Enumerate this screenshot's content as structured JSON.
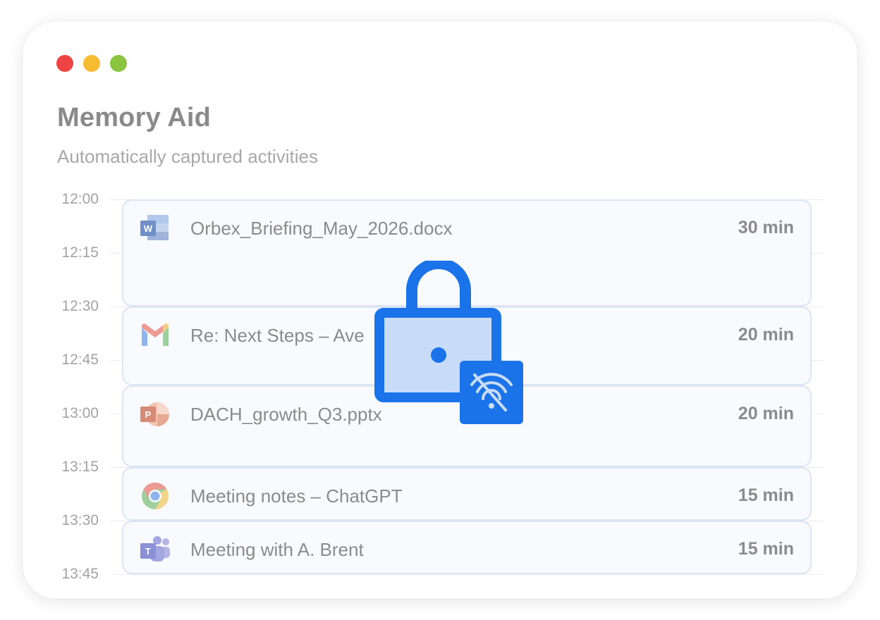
{
  "window": {
    "controls": [
      "close",
      "minimize",
      "zoom"
    ]
  },
  "header": {
    "title": "Memory Aid",
    "subtitle": "Automatically captured activities"
  },
  "timeline": {
    "times": [
      "12:00",
      "12:15",
      "12:30",
      "12:45",
      "13:00",
      "13:15",
      "13:30",
      "13:45"
    ]
  },
  "activities": [
    {
      "app_icon": "word-icon",
      "name": "Orbex_Briefing_May_2026.docx",
      "duration": "30 min"
    },
    {
      "app_icon": "gmail-icon",
      "name": "Re: Next Steps – Ave",
      "duration": "20 min"
    },
    {
      "app_icon": "powerpoint-icon",
      "name": "DACH_growth_Q3.pptx",
      "duration": "20 min"
    },
    {
      "app_icon": "chrome-icon",
      "name": "Meeting notes – ChatGPT",
      "duration": "15 min"
    },
    {
      "app_icon": "teams-icon",
      "name": "Meeting with A. Brent",
      "duration": "15 min"
    }
  ],
  "overlay": {
    "icon": "lock-offline-icon",
    "accent": "#1a73e8",
    "fill": "#c8dcf7"
  },
  "colors": {
    "close": "#ee4444",
    "minimize": "#f8bc33",
    "zoom": "#8bc540"
  }
}
